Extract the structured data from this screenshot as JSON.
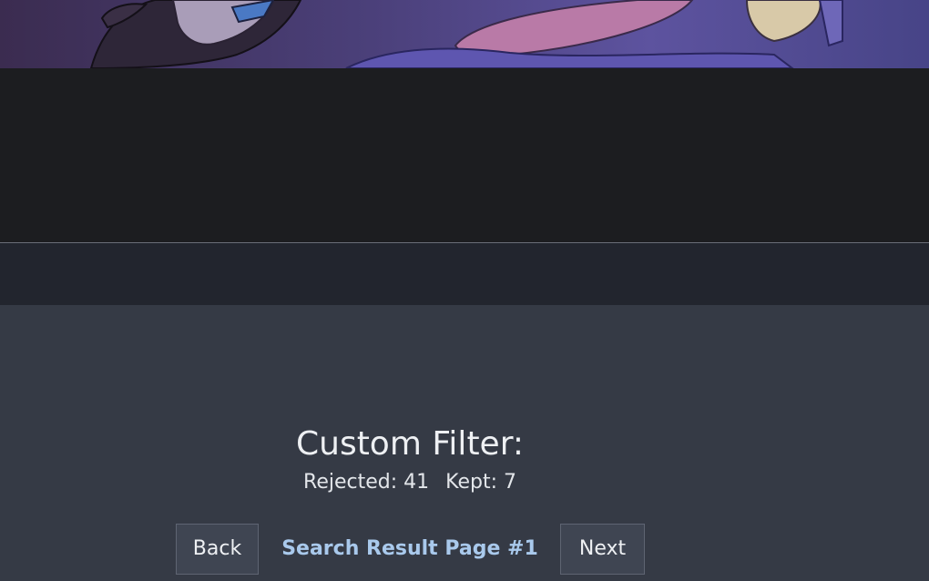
{
  "filter": {
    "title": "Custom Filter:",
    "rejected_label": "Rejected: 41",
    "kept_label": "Kept: 7"
  },
  "pager": {
    "back_label": "Back",
    "page_label": "Search Result Page #1",
    "next_label": "Next"
  },
  "colors": {
    "accent_link": "#a9c9ec",
    "background": "#353a45",
    "dark_band": "#1c1d20",
    "nav_strip": "#22252e"
  }
}
